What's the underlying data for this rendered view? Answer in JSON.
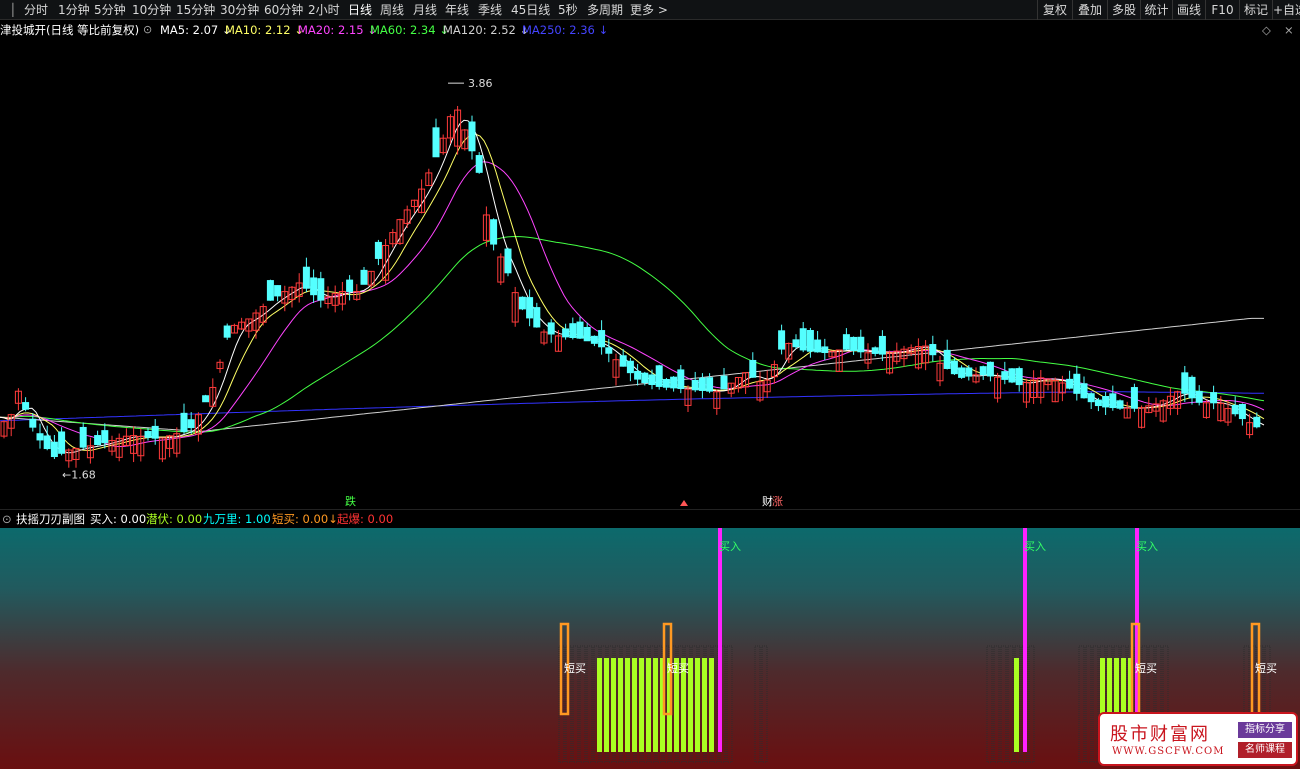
{
  "toolbar": {
    "periods": [
      "分时",
      "1分钟",
      "5分钟",
      "10分钟",
      "15分钟",
      "30分钟",
      "60分钟",
      "2小时",
      "日线",
      "周线",
      "月线",
      "年线",
      "季线",
      "45日线",
      "5秒",
      "多周期",
      "更多 >"
    ],
    "active_period": "日线",
    "right_buttons": [
      "复权",
      "叠加",
      "多股",
      "统计",
      "画线",
      "F10",
      "标记",
      "+自选"
    ]
  },
  "chart_header": {
    "stock_name": "津投城开(日线 等比前复权)",
    "ma": [
      {
        "label": "MA5: 2.07",
        "color": "#ffffff"
      },
      {
        "label": "MA10: 2.12",
        "color": "#ffff66"
      },
      {
        "label": "MA20: 2.15",
        "color": "#ff44ff"
      },
      {
        "label": "MA60: 2.34",
        "color": "#44ff44"
      },
      {
        "label": "MA120: 2.52",
        "color": "#d0d0d0"
      },
      {
        "label": "MA250: 2.36",
        "color": "#4444ff"
      }
    ],
    "trend_arrow": "↓",
    "diamond_icon": "◇",
    "close_icon": "×"
  },
  "price_annotations": {
    "high": "3.86",
    "low": "1.68",
    "markers": [
      {
        "text": "跌",
        "color": "#44ff44"
      },
      {
        "text": "涨",
        "color": "#ff6666"
      },
      {
        "text": "财",
        "color": "#ffffff"
      }
    ]
  },
  "indicator": {
    "name": "扶摇刀刃副图",
    "values": [
      {
        "label": "买入:",
        "value": "0.00",
        "color": "#ffffff"
      },
      {
        "label": "潜伏:",
        "value": "0.00",
        "color": "#aaff22"
      },
      {
        "label": "九万里:",
        "value": "1.00",
        "color": "#00ffff"
      },
      {
        "label": "短买:",
        "value": "0.00",
        "color": "#ff9922",
        "arrow": "↓"
      },
      {
        "label": "起爆:",
        "value": "0.00",
        "color": "#ff3333"
      }
    ],
    "signals": {
      "buy": "买入",
      "short_buy": "短买"
    }
  },
  "watermark": {
    "title": "股市财富网",
    "url": "WWW.GSCFW.COM",
    "tag1": "指标分享",
    "tag2": "名师课程"
  },
  "colors": {
    "up": "#ff3b3b",
    "down": "#54ffff",
    "ma5": "#ffffff",
    "ma10": "#ffff66",
    "ma20": "#ff44ff",
    "ma60": "#44ff44",
    "ma120": "#d0d0d0",
    "ma250": "#3333ff",
    "buy_line": "#ff22ff",
    "lime_bar": "#aaff22",
    "short_buy": "#ff9922"
  }
}
